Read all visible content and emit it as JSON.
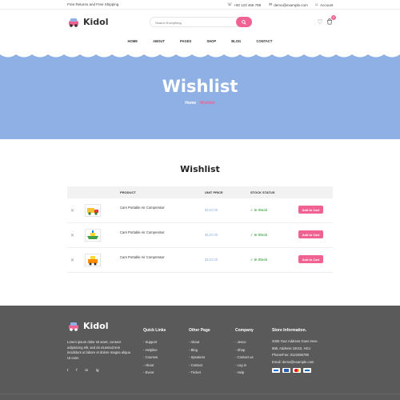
{
  "topbar": {
    "promo": "Free Returns and Free Shipping",
    "phone": "+00 123 456 789",
    "email": "demo@example.com",
    "account": "Account"
  },
  "header": {
    "logo_text": "Kidol",
    "search_placeholder": "Search Everything",
    "cart_count": "0"
  },
  "nav": [
    "HOME",
    "ABOUT",
    "PAGES",
    "SHOP",
    "BLOG",
    "CONTACT"
  ],
  "banner": {
    "title": "Wishlist",
    "crumb_home": "Home",
    "crumb_current": "Wishlist"
  },
  "wishlist": {
    "heading": "Wishlist",
    "columns": {
      "product": "PRODUCT",
      "unit_price": "UNIT PRICE",
      "stock_status": "STOCK STATUS"
    },
    "items": [
      {
        "name": "Cars Portable Air Compressor",
        "price": "$120.00",
        "stock": "In Stock",
        "button": "Add to Cart",
        "icon": "toy-truck-icon"
      },
      {
        "name": "Cars Portable Air Compressor",
        "price": "$120.00",
        "stock": "In Stock",
        "button": "Add to Cart",
        "icon": "toy-boat-icon"
      },
      {
        "name": "Cars Portable Air Compressor",
        "price": "$120.00",
        "stock": "In Stock",
        "button": "Add to Cart",
        "icon": "toy-car-icon"
      }
    ]
  },
  "footer": {
    "logo_text": "Kidol",
    "about": "Lorem ipsum dolor sit amet, consect adipisicing elit, sed do eiusmod tem incididunt ut labore et dolore magna aliqua Ut enim",
    "social": [
      "t",
      "f",
      "in",
      "ig"
    ],
    "quick_links": {
      "title": "Quick Links",
      "items": [
        "Support",
        "Helpline",
        "Courses",
        "About",
        "Event"
      ]
    },
    "other_page": {
      "title": "Other Page",
      "items": [
        "About",
        "Blog",
        "Speakers",
        "Contact",
        "Tricket"
      ]
    },
    "company": {
      "title": "Company",
      "items": [
        "Jesco",
        "Shop",
        "Contact us",
        "Log in",
        "Help"
      ]
    },
    "store": {
      "title": "Store Information.",
      "items": [
        "2005 Your Address Goes Here.",
        "896, Address 10010, HGJ",
        "Phone/Fax: 0123456789",
        "Email: demo@example.com"
      ]
    }
  },
  "colors": {
    "accent": "#f06292",
    "banner": "#8fb0e4",
    "stock": "#4caf50",
    "footer": "#5a5a5a"
  }
}
